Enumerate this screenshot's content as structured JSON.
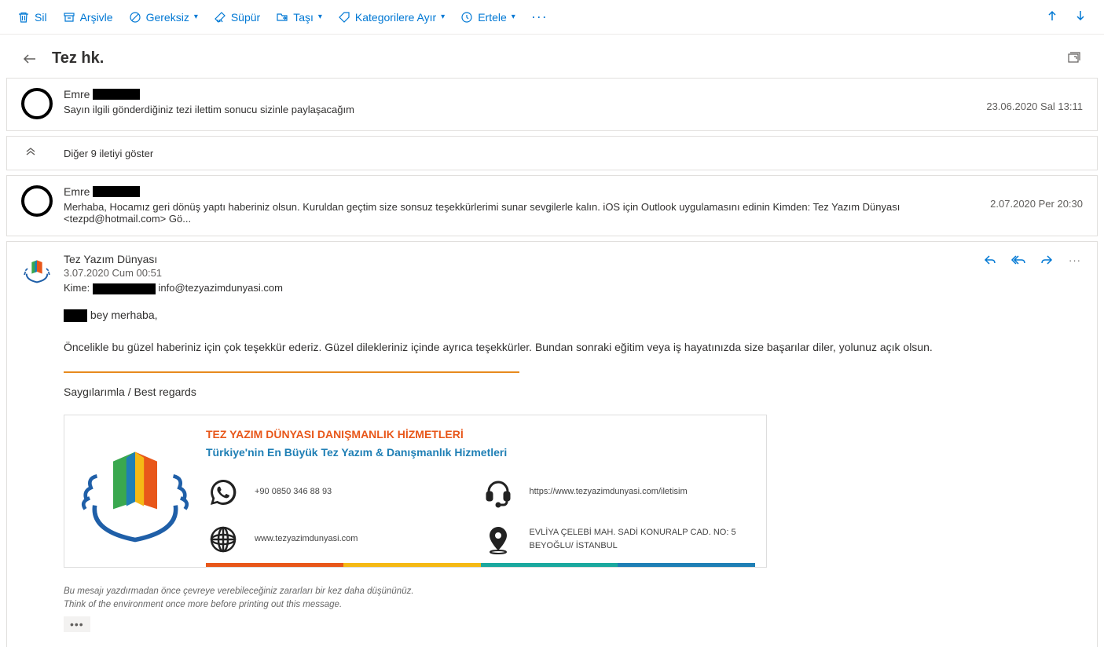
{
  "toolbar": {
    "delete": "Sil",
    "archive": "Arşivle",
    "junk": "Gereksiz",
    "sweep": "Süpür",
    "move": "Taşı",
    "categorize": "Kategorilere Ayır",
    "snooze": "Ertele"
  },
  "subject": "Tez hk.",
  "messages": [
    {
      "from_prefix": "Emre",
      "preview": "Sayın ilgili gönderdiğiniz tezi ilettim sonucu sizinle paylaşacağım",
      "date": "23.06.2020 Sal 13:11"
    },
    {
      "from_prefix": "Emre",
      "preview": "Merhaba, Hocamız geri dönüş yaptı haberiniz olsun. Kuruldan geçtim size sonsuz teşekkürlerimi sunar sevgilerle kalın. iOS için Outlook uygulamasını edinin Kimden: Tez Yazım Dünyası <tezpd@hotmail.com> Gö...",
      "date": "2.07.2020 Per 20:30"
    }
  ],
  "expand_label": "Diğer 9 iletiyi göster",
  "detail": {
    "from": "Tez Yazım Dünyası",
    "date": "3.07.2020 Cum 00:51",
    "to_label": "Kime:",
    "to_email": "info@tezyazimdunyasi.com",
    "greeting_suffix": " bey merhaba,",
    "body_p1": "Öncelikle bu güzel haberiniz için çok teşekkür ederiz. Güzel dilekleriniz içinde ayrıca teşekkürler. Bundan sonraki eğitim veya iş hayatınızda size başarılar diler, yolunuz açık olsun.",
    "regards": "Saygılarımla / Best regards",
    "sig": {
      "title": "TEZ YAZIM DÜNYASI DANIŞMANLIK HİZMETLERİ",
      "subtitle": "Türkiye'nin En Büyük Tez Yazım & Danışmanlık Hizmetleri",
      "phone": "+90 0850 346 88 93",
      "url": "https://www.tezyazimdunyasi.com/iletisim",
      "web": "www.tezyazimdunyasi.com",
      "address": "EVLİYA ÇELEBİ MAH. SADİ KONURALP CAD. NO: 5 BEYOĞLU/ İSTANBUL"
    },
    "env_tr": "Bu mesajı yazdırmadan önce çevreye verebileceğiniz zararları bir kez daha düşününüz.",
    "env_en": "Think of the environment once more before printing out this message."
  }
}
